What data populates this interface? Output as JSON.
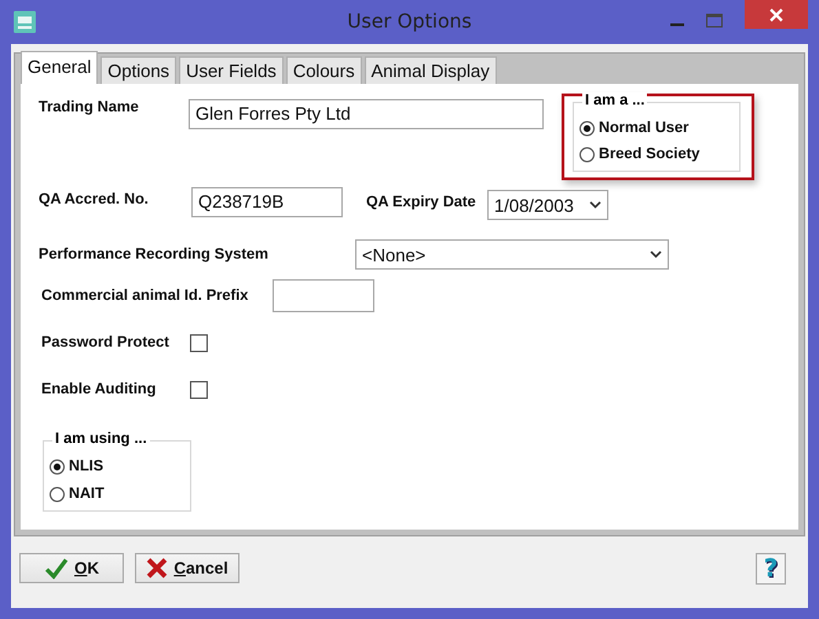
{
  "window": {
    "title": "User Options"
  },
  "tabs": [
    {
      "label": "General",
      "selected": true
    },
    {
      "label": "Options",
      "selected": false
    },
    {
      "label": "User Fields",
      "selected": false
    },
    {
      "label": "Colours",
      "selected": false
    },
    {
      "label": "Animal Display",
      "selected": false
    }
  ],
  "trading_name": {
    "label": "Trading Name",
    "value": "Glen Forres Pty Ltd"
  },
  "user_type": {
    "title": "I am a ...",
    "highlighted": true,
    "options": [
      {
        "label": "Normal User",
        "selected": true
      },
      {
        "label": "Breed Society",
        "selected": false
      }
    ]
  },
  "qa_accred": {
    "label": "QA Accred. No.",
    "value": "Q238719B"
  },
  "qa_expiry": {
    "label": "QA Expiry Date",
    "value": "1/08/2003"
  },
  "performance": {
    "label": "Performance Recording System",
    "value": "<None>"
  },
  "prefix": {
    "label": "Commercial animal Id. Prefix"
  },
  "checkboxes": [
    {
      "label": "Password Protect",
      "checked": false
    },
    {
      "label": "Enable Auditing",
      "checked": false
    }
  ],
  "id_system": {
    "title": "I am using ...",
    "options": [
      {
        "label": "NLIS",
        "selected": true
      },
      {
        "label": "NAIT",
        "selected": false
      }
    ]
  },
  "buttons": [
    {
      "label": "OK",
      "kind": "ok"
    },
    {
      "label": "Cancel",
      "kind": "cancel"
    }
  ],
  "help_button": {
    "label": "?"
  }
}
